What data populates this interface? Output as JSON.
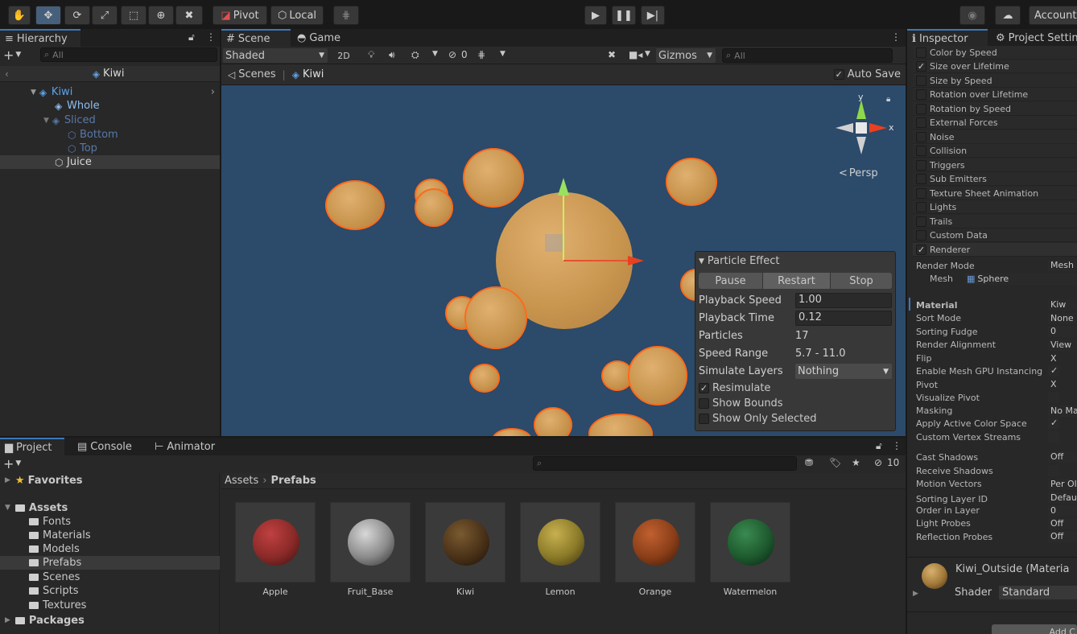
{
  "toolbar": {
    "pivot": "Pivot",
    "local": "Local",
    "account": "Account"
  },
  "hierarchy": {
    "tab": "Hierarchy",
    "search_placeholder": "All",
    "scene_name": "Kiwi",
    "items": [
      {
        "label": "Kiwi",
        "color": "#5ea2e8"
      },
      {
        "label": "Whole",
        "color": "#8fbdf0"
      },
      {
        "label": "Sliced",
        "color": "#5878a8"
      },
      {
        "label": "Bottom",
        "color": "#5878a8"
      },
      {
        "label": "Top",
        "color": "#5878a8"
      },
      {
        "label": "Juice",
        "color": "#d0d0d0"
      }
    ]
  },
  "scene": {
    "tab_scene": "Scene",
    "tab_game": "Game",
    "shading": "Shaded",
    "mode_2d": "2D",
    "hidden_count": "0",
    "gizmos": "Gizmos",
    "search_placeholder": "All",
    "breadcrumb_root": "Scenes",
    "breadcrumb_current": "Kiwi",
    "auto_save": "Auto Save",
    "persp": "Persp",
    "axis_x": "x",
    "axis_y": "y"
  },
  "particle_effect": {
    "title": "Particle Effect",
    "pause": "Pause",
    "restart": "Restart",
    "stop": "Stop",
    "playback_speed_label": "Playback Speed",
    "playback_speed": "1.00",
    "playback_time_label": "Playback Time",
    "playback_time": "0.12",
    "particles_label": "Particles",
    "particles": "17",
    "speed_range_label": "Speed Range",
    "speed_range": "5.7 - 11.0",
    "simulate_layers_label": "Simulate Layers",
    "simulate_layers": "Nothing",
    "resimulate": "Resimulate",
    "show_bounds": "Show Bounds",
    "show_only_selected": "Show Only Selected"
  },
  "project": {
    "tab_project": "Project",
    "tab_console": "Console",
    "tab_animator": "Animator",
    "favorites": "Favorites",
    "assets": "Assets",
    "folders": [
      "Fonts",
      "Materials",
      "Models",
      "Prefabs",
      "Scenes",
      "Scripts",
      "Textures"
    ],
    "packages": "Packages",
    "breadcrumb_root": "Assets",
    "breadcrumb_current": "Prefabs",
    "hidden_count": "10",
    "prefabs": [
      {
        "name": "Apple",
        "color": "#8a2a28"
      },
      {
        "name": "Fruit_Base",
        "color": "#8a8a8a"
      },
      {
        "name": "Kiwi",
        "color": "#4a3218"
      },
      {
        "name": "Lemon",
        "color": "#8a7a28"
      },
      {
        "name": "Orange",
        "color": "#8a3e18"
      },
      {
        "name": "Watermelon",
        "color": "#1e5a2e"
      }
    ]
  },
  "inspector": {
    "tab_inspector": "Inspector",
    "tab_project_settings": "Project Settin",
    "modules": [
      {
        "label": "Color by Speed",
        "checked": false
      },
      {
        "label": "Size over Lifetime",
        "checked": true
      },
      {
        "label": "Size by Speed",
        "checked": false
      },
      {
        "label": "Rotation over Lifetime",
        "checked": false
      },
      {
        "label": "Rotation by Speed",
        "checked": false
      },
      {
        "label": "External Forces",
        "checked": false
      },
      {
        "label": "Noise",
        "checked": false
      },
      {
        "label": "Collision",
        "checked": false
      },
      {
        "label": "Triggers",
        "checked": false
      },
      {
        "label": "Sub Emitters",
        "checked": false
      },
      {
        "label": "Texture Sheet Animation",
        "checked": false
      },
      {
        "label": "Lights",
        "checked": false
      },
      {
        "label": "Trails",
        "checked": false
      },
      {
        "label": "Custom Data",
        "checked": false
      },
      {
        "label": "Renderer",
        "checked": true
      }
    ],
    "render_mode_label": "Render Mode",
    "render_mode": "Mesh",
    "mesh_label": "Mesh",
    "mesh": "Sphere",
    "props": [
      {
        "label": "Material",
        "value": "Kiw"
      },
      {
        "label": "Sort Mode",
        "value": "None"
      },
      {
        "label": "Sorting Fudge",
        "value": "0"
      },
      {
        "label": "Render Alignment",
        "value": "View"
      },
      {
        "label": "Flip",
        "value": "X"
      },
      {
        "label": "Enable Mesh GPU Instancing",
        "value": "✓"
      },
      {
        "label": "Pivot",
        "value": "X"
      },
      {
        "label": "Visualize Pivot",
        "value": ""
      },
      {
        "label": "Masking",
        "value": "No Ma"
      },
      {
        "label": "Apply Active Color Space",
        "value": "✓"
      },
      {
        "label": "Custom Vertex Streams",
        "value": ""
      },
      {
        "label": "Cast Shadows",
        "value": "Off"
      },
      {
        "label": "Receive Shadows",
        "value": ""
      },
      {
        "label": "Motion Vectors",
        "value": "Per Ol"
      },
      {
        "label": "Sorting Layer ID",
        "value": "Defau"
      },
      {
        "label": "Order in Layer",
        "value": "0"
      },
      {
        "label": "Light Probes",
        "value": "Off"
      },
      {
        "label": "Reflection Probes",
        "value": "Off"
      }
    ],
    "material_name": "Kiwi_Outside (Materia",
    "shader_label": "Shader",
    "shader": "Standard",
    "add_component": "Add C"
  }
}
